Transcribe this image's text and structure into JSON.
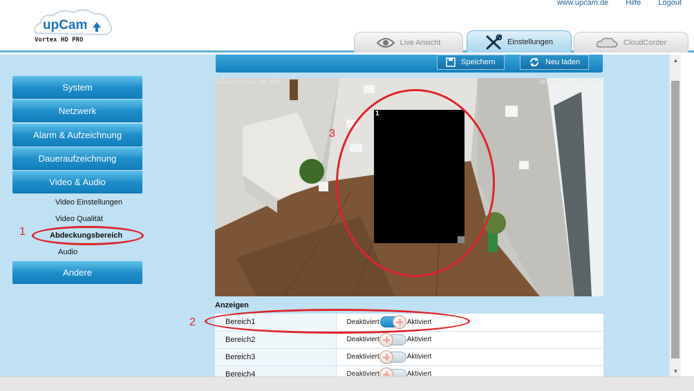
{
  "header": {
    "logo": {
      "brand": "upCam",
      "model": "Vortex HD PRO"
    },
    "links": [
      "www.upcam.de",
      "Hilfe",
      "Logout"
    ],
    "tabs": [
      {
        "label": "Live Ansicht",
        "icon": "eye-icon",
        "active": false
      },
      {
        "label": "Einstellungen",
        "icon": "tools-icon",
        "active": true
      },
      {
        "label": "CloudCorder",
        "icon": "cloud-icon",
        "active": false
      }
    ]
  },
  "sidebar": {
    "items": [
      {
        "label": "System"
      },
      {
        "label": "Netzwerk"
      },
      {
        "label": "Alarm & Aufzeichnung"
      },
      {
        "label": "Daueraufzeichnung"
      },
      {
        "label": "Video & Audio"
      },
      {
        "label": "Andere"
      }
    ],
    "sub_items": [
      {
        "label": "Video Einstellungen",
        "active": false
      },
      {
        "label": "Video Qualität",
        "active": false
      },
      {
        "label": "Abdeckungsbereich",
        "active": true
      },
      {
        "label": "Audio",
        "active": false
      }
    ]
  },
  "toolbar": {
    "save_label": "Speichern",
    "reload_label": "Neu laden"
  },
  "video": {
    "osd_left": "upCam Vortex HD PRO",
    "osd_right": "2018-08-18 12:11:49",
    "mask_number": "1"
  },
  "areas": {
    "section_label": "Anzeigen",
    "off_label": "Deaktiviert",
    "on_label": "Aktiviert",
    "rows": [
      {
        "name": "Bereich1",
        "enabled": true
      },
      {
        "name": "Bereich2",
        "enabled": false
      },
      {
        "name": "Bereich3",
        "enabled": false
      },
      {
        "name": "Bereich4",
        "enabled": false
      }
    ]
  },
  "annotations": [
    "1",
    "2",
    "3"
  ],
  "colors": {
    "accent": "#1d8cc7",
    "panel_bg": "#bfe1f3",
    "annotation": "#e0222a"
  }
}
